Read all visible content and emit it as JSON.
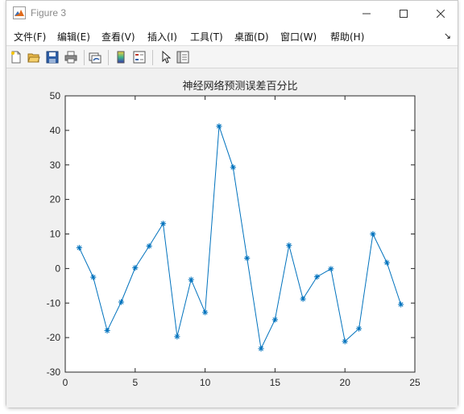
{
  "window": {
    "title": "Figure 3"
  },
  "menu": [
    "文件(F)",
    "编辑(E)",
    "查看(V)",
    "插入(I)",
    "工具(T)",
    "桌面(D)",
    "窗口(W)",
    "帮助(H)"
  ],
  "menu_overflow_icon": "dock-arrow-icon",
  "toolbar": [
    "new-figure-icon",
    "open-file-icon",
    "save-icon",
    "print-icon",
    "link-plot-icon",
    "insert-colorbar-icon",
    "insert-legend-icon",
    "edit-plot-arrow-icon",
    "property-inspector-icon"
  ],
  "colors": {
    "line": "#0072bd",
    "axes_bg": "#ffffff",
    "figure_bg": "#f0f0f0"
  },
  "chart_data": {
    "type": "line",
    "title": "神经网络预测误差百分比",
    "marker": "*",
    "x": [
      1,
      2,
      3,
      4,
      5,
      6,
      7,
      8,
      9,
      10,
      11,
      12,
      13,
      14,
      15,
      16,
      17,
      18,
      19,
      20,
      21,
      22,
      23,
      24
    ],
    "y": [
      6,
      -2.5,
      -18,
      -9.7,
      0.2,
      6.5,
      13,
      -19.7,
      -3.2,
      -12.7,
      41.2,
      29.3,
      3,
      -23.2,
      -14.8,
      6.7,
      -8.8,
      -2.4,
      -0.1,
      -21.1,
      -17.4,
      10,
      1.7,
      -10.4
    ],
    "xlim": [
      0,
      25
    ],
    "ylim": [
      -30,
      50
    ],
    "xticks": [
      "0",
      "5",
      "10",
      "15",
      "20",
      "25"
    ],
    "yticks": [
      "-30",
      "-20",
      "-10",
      "0",
      "10",
      "20",
      "30",
      "40",
      "50"
    ],
    "xlabel": "",
    "ylabel": "",
    "grid": false,
    "legend": false
  }
}
